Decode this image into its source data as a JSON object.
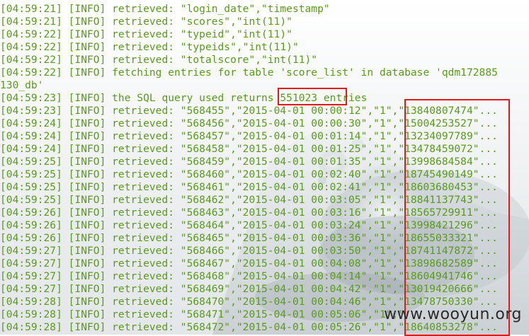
{
  "terminal": {
    "text_color": "#5a9a1c",
    "lines": [
      "[04:59:21] [INFO] retrieved: \"login_date\",\"timestamp\"",
      "[04:59:21] [INFO] retrieved: \"scores\",\"int(11)\"",
      "[04:59:22] [INFO] retrieved: \"typeid\",\"int(11)\"",
      "[04:59:22] [INFO] retrieved: \"typeids\",\"int(11)\"",
      "[04:59:22] [INFO] retrieved: \"totalscore\",\"int(11)\"",
      "[04:59:22] [INFO] fetching entries for table 'score_list' in database 'qdm172885",
      "130_db'",
      "[04:59:23] [INFO] the SQL query used returns 551023 entries",
      "[04:59:23] [INFO] retrieved: \"568455\",\"2015-04-01 00:00:12\",\"1\",\"13840807474\"...",
      "[04:59:24] [INFO] retrieved: \"568456\",\"2015-04-01 00:00:30\",\"1\",\"15004253527\"...",
      "[04:59:24] [INFO] retrieved: \"568457\",\"2015-04-01 00:01:14\",\"1\",\"13234097789\"...",
      "[04:59:24] [INFO] retrieved: \"568458\",\"2015-04-01 00:01:25\",\"1\",\"13478459072\"...",
      "[04:59:25] [INFO] retrieved: \"568459\",\"2015-04-01 00:01:35\",\"1\",\"13998684584\"...",
      "[04:59:25] [INFO] retrieved: \"568460\",\"2015-04-01 00:02:40\",\"1\",\"18745490149\"...",
      "[04:59:25] [INFO] retrieved: \"568461\",\"2015-04-01 00:02:41\",\"1\",\"18603680453\"...",
      "[04:59:25] [INFO] retrieved: \"568462\",\"2015-04-01 00:03:05\",\"1\",\"18841137743\"...",
      "[04:59:26] [INFO] retrieved: \"568463\",\"2015-04-01 00:03:16\",\"1\",\"18565729911\"...",
      "[04:59:26] [INFO] retrieved: \"568464\",\"2015-04-01 00:03:24\",\"1\",\"13998421296\"...",
      "[04:59:26] [INFO] retrieved: \"568465\",\"2015-04-01 00:03:36\",\"1\",\"18655033321\"...",
      "[04:59:27] [INFO] retrieved: \"568466\",\"2015-04-01 00:03:50\",\"1\",\"18741147872\"...",
      "[04:59:27] [INFO] retrieved: \"568467\",\"2015-04-01 00:04:08\",\"1\",\"13898682589\"...",
      "[04:59:27] [INFO] retrieved: \"568468\",\"2015-04-01 00:04:14\",\"1\",\"18604941746\"...",
      "[04:59:27] [INFO] retrieved: \"568469\",\"2015-04-01 00:04:42\",\"1\",\"13019420666\"...",
      "[04:59:28] [INFO] retrieved: \"568470\",\"2015-04-01 00:04:46\",\"1\",\"13478750330\"...",
      "[04:59:28] [INFO] retrieved: \"568471\",\"2015-04-01 00:05:06\",\"1\",\"",
      "[04:59:28] [INFO] retrieved: \"568472\",\"2015-04-01 00:05:26\",\"1\",\"18640853278\"..."
    ]
  },
  "highlights": {
    "color": "#e01b1b"
  },
  "watermark": {
    "text": "www.wooyun.org"
  }
}
